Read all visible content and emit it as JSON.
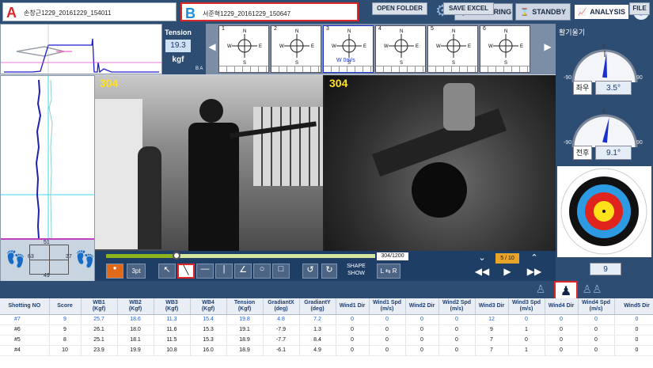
{
  "sessions": [
    {
      "letter": "A",
      "name": "손창근1229_20161229_154011",
      "color": "#e02626"
    },
    {
      "letter": "B",
      "name": "서준혁1229_20161229_150647",
      "color": "#1a8fe0"
    }
  ],
  "toolbar": {
    "measuring": "MEASURING",
    "standby": "STANDBY",
    "analysis": "ANALYSIS"
  },
  "tension": {
    "label": "Tension",
    "value": "19.3",
    "unit": "kgf",
    "ba": "B A"
  },
  "wind_cells": [
    {
      "n": "1",
      "label": ""
    },
    {
      "n": "2",
      "label": ""
    },
    {
      "n": "3",
      "label": "W 0m/s"
    },
    {
      "n": "4",
      "label": ""
    },
    {
      "n": "5",
      "label": ""
    },
    {
      "n": "6",
      "label": ""
    }
  ],
  "compass": {
    "n": "N",
    "s": "S",
    "w": "W",
    "e": "E"
  },
  "right": {
    "title": "활기울기",
    "g1": {
      "label": "좌우",
      "value": "3.5°",
      "min": "-90",
      "zero": "0",
      "max": "90"
    },
    "g2": {
      "label": "전후",
      "value": "9.1°",
      "min": "-90",
      "zero": "0",
      "max": "90"
    },
    "target_value": "9"
  },
  "left_graph": {
    "top": "51",
    "left": "63",
    "right": "37",
    "bottom": "49"
  },
  "video": {
    "frame_left": "304",
    "frame_right": "304"
  },
  "controls": {
    "frame_counter": "304/1200",
    "page": "5 / 10",
    "pt": "3pt",
    "shape_show": "SHAPE SHOW",
    "lr": "L ⇆ R"
  },
  "midbar": {
    "open_folder": "OPEN FOLDER",
    "save_excel": "SAVE EXCEL",
    "file": "FILE"
  },
  "table": {
    "headers": [
      "Shotting NO",
      "Score",
      "WB1\n(Kgf)",
      "WB2\n(Kgf)",
      "WB3\n(Kgf)",
      "WB4\n(Kgf)",
      "Tension\n(Kgf)",
      "GradiantX\n(deg)",
      "GradiantY\n(deg)",
      "Wind1 Dir",
      "Wind1 Spd\n(m/s)",
      "Wind2 Dir",
      "Wind2 Spd\n(m/s)",
      "Wind3 Dir",
      "Wind3 Spd\n(m/s)",
      "Wind4 Dir",
      "Wind4 Spd\n(m/s)",
      "Wind5 Dir"
    ],
    "rows": [
      [
        "#7",
        "9",
        "25.7",
        "18.6",
        "11.3",
        "15.4",
        "19.8",
        "4.8",
        "7.2",
        "0",
        "0",
        "0",
        "0",
        "12",
        "0",
        "0",
        "0",
        "0"
      ],
      [
        "#6",
        "9",
        "26.1",
        "18.0",
        "11.6",
        "15.3",
        "19.1",
        "-7.9",
        "1.3",
        "0",
        "0",
        "0",
        "0",
        "9",
        "1",
        "0",
        "0",
        "0"
      ],
      [
        "#5",
        "8",
        "25.1",
        "18.1",
        "11.5",
        "15.3",
        "18.9",
        "-7.7",
        "8.4",
        "0",
        "0",
        "0",
        "0",
        "7",
        "0",
        "0",
        "0",
        "0"
      ],
      [
        "#4",
        "10",
        "23.9",
        "19.9",
        "10.8",
        "16.0",
        "18.9",
        "-6.1",
        "4.9",
        "0",
        "0",
        "0",
        "0",
        "7",
        "1",
        "0",
        "0",
        "0"
      ]
    ]
  }
}
